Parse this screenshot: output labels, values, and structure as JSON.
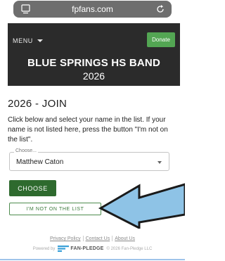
{
  "browser": {
    "url": "fpfans.com",
    "tabs_icon": "tabs-icon",
    "reload_icon": "reload-icon"
  },
  "header": {
    "menu_label": "MENU",
    "donate_label": "Donate",
    "band_name": "BLUE SPRINGS HS BAND",
    "year": "2026"
  },
  "join": {
    "title": "2026 - JOIN",
    "instructions": "Click below and select your name in the list. If your name is not listed here, press the button \"I'm not on the list\".",
    "select_label": "Choose...",
    "select_value": "Matthew Caton",
    "choose_button": "CHOOSE",
    "not_on_list_button": "I'M NOT ON THE LIST"
  },
  "footer": {
    "privacy": "Privacy Policy",
    "contact": "Contact Us",
    "about": "About Us",
    "powered_by": "Powered by",
    "brand": "FAN-PLEDGE",
    "copyright": "© 2026 Fan-Pledge LLC"
  },
  "colors": {
    "header_bg": "#2b2b2b",
    "donate_green": "#53a653",
    "choose_green": "#2e6a2e",
    "arrow_fill": "#8ec3e6"
  }
}
